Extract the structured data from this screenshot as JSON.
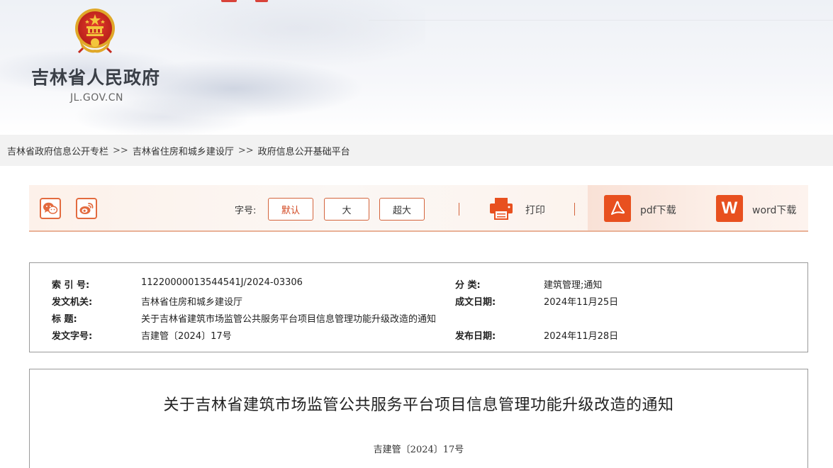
{
  "header": {
    "site_name": "吉林省人民政府",
    "site_domain": "JL.GOV.CN"
  },
  "breadcrumb": {
    "separator": ">>",
    "items": [
      "吉林省政府信息公开专栏",
      "吉林省住房和城乡建设厅",
      "政府信息公开基础平台"
    ]
  },
  "toolbar": {
    "font_size_label": "字号:",
    "font_sizes": [
      "默认",
      "大",
      "超大"
    ],
    "print_label": "打印",
    "pdf_label": "pdf下载",
    "word_label": "word下载",
    "word_icon_letter": "W",
    "accent_color": "#e8501f"
  },
  "meta": {
    "index_label": "索 引 号:",
    "index_value": "11220000013544541J/2024-03306",
    "category_label": "分 类:",
    "category_value": "建筑管理;通知",
    "issuer_label": "发文机关:",
    "issuer_value": "吉林省住房和城乡建设厅",
    "created_label": "成文日期:",
    "created_value": "2024年11月25日",
    "title_label": "标 题:",
    "title_value": "关于吉林省建筑市场监管公共服务平台项目信息管理功能升级改造的通知",
    "docno_label": "发文字号:",
    "docno_value": "吉建管〔2024〕17号",
    "published_label": "发布日期:",
    "published_value": "2024年11月28日"
  },
  "article": {
    "title": "关于吉林省建筑市场监管公共服务平台项目信息管理功能升级改造的通知",
    "doc_number": "吉建管〔2024〕17号"
  }
}
